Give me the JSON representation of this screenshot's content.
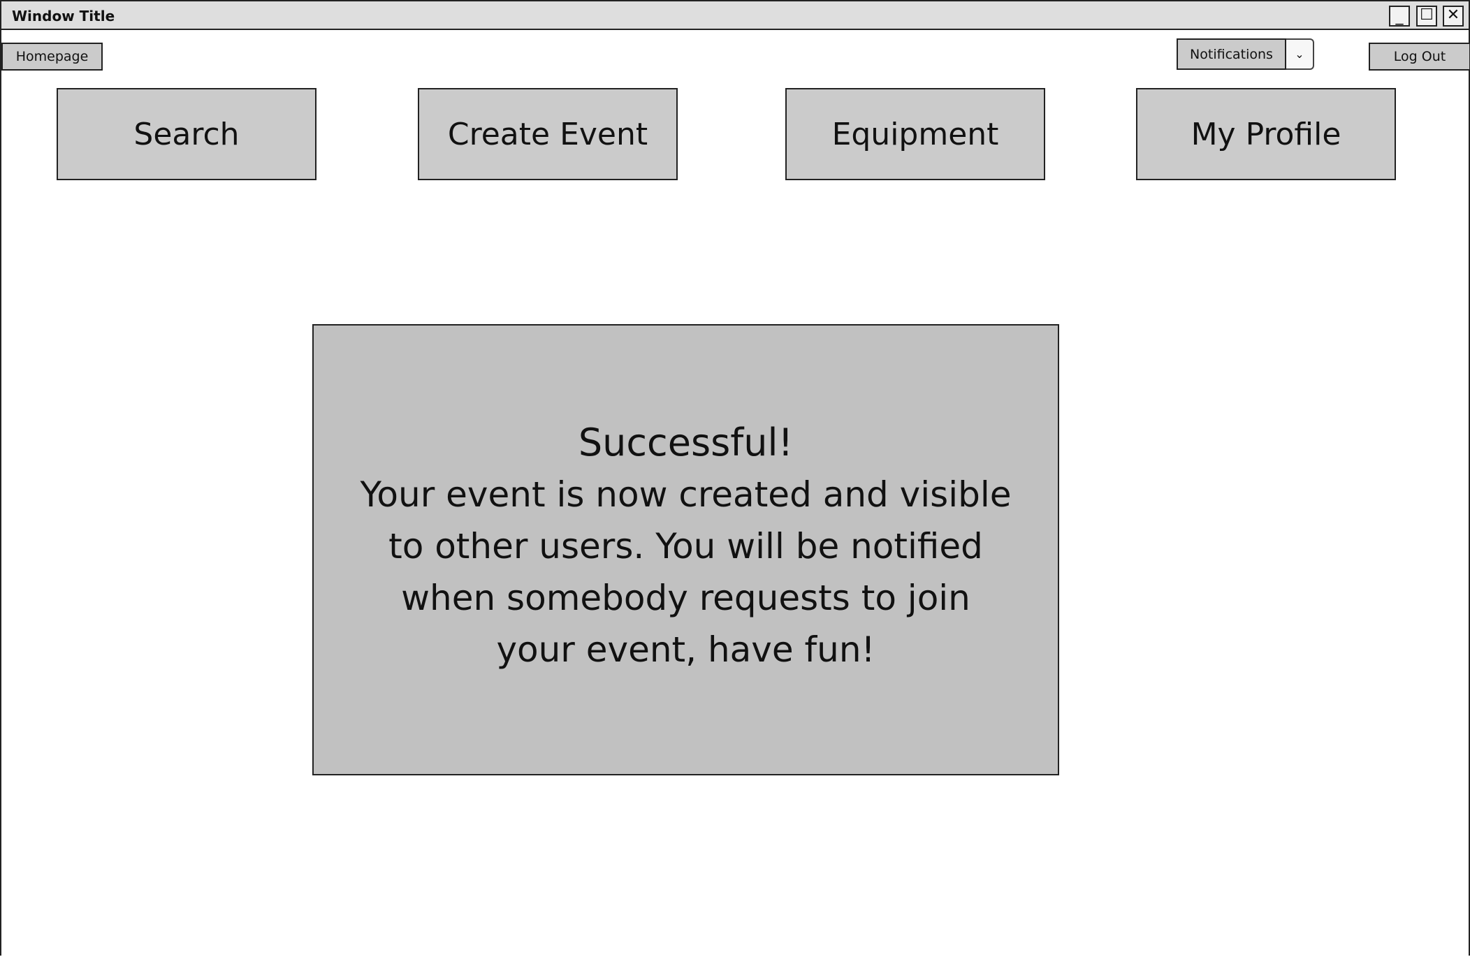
{
  "window": {
    "title": "Window Title",
    "controls": {
      "minimize": "_",
      "maximize": "☐",
      "close": "✕"
    }
  },
  "header": {
    "homepage_label": "Homepage",
    "notifications_label": "Notifications",
    "notifications_arrow": "⌄",
    "logout_label": "Log Out"
  },
  "nav": {
    "search": "Search",
    "create_event": "Create Event",
    "equipment": "Equipment",
    "my_profile": "My Profile"
  },
  "dialog": {
    "title": "Successful!",
    "message": "Your event is now created and visible to other users. You will be notified when somebody requests to join your event, have fun!"
  }
}
